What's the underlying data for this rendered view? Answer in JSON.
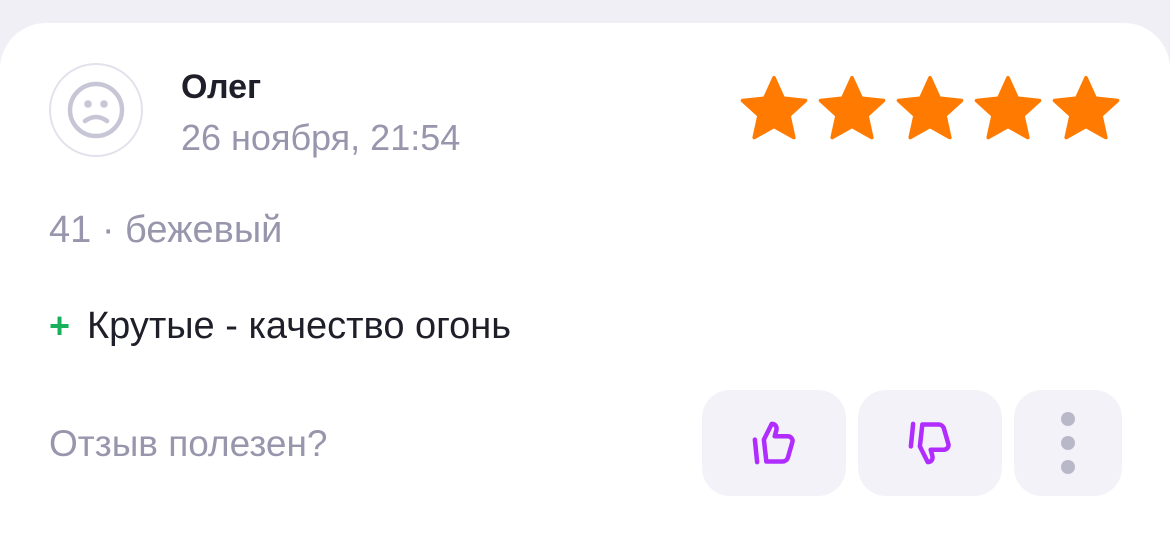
{
  "review": {
    "author": "Олег",
    "date": "26 ноября, 21:54",
    "rating": 5,
    "rating_max": 5,
    "variant": "41 · бежевый",
    "pros_marker": "+",
    "pros_text": "Крутые - качество огонь",
    "helpful_question": "Отзыв полезен?"
  },
  "icons": {
    "avatar": "sad-face-icon",
    "rating_star": "star-icon",
    "like": "thumbs-up-icon",
    "dislike": "thumbs-down-icon",
    "more": "more-vertical-icon"
  },
  "colors": {
    "star": "#ff7a00",
    "vote_icon": "#b02cff",
    "pros_plus": "#18b05a",
    "secondary_text": "#9896ad",
    "primary_text": "#1f1f29",
    "button_bg": "#f3f2f8"
  }
}
